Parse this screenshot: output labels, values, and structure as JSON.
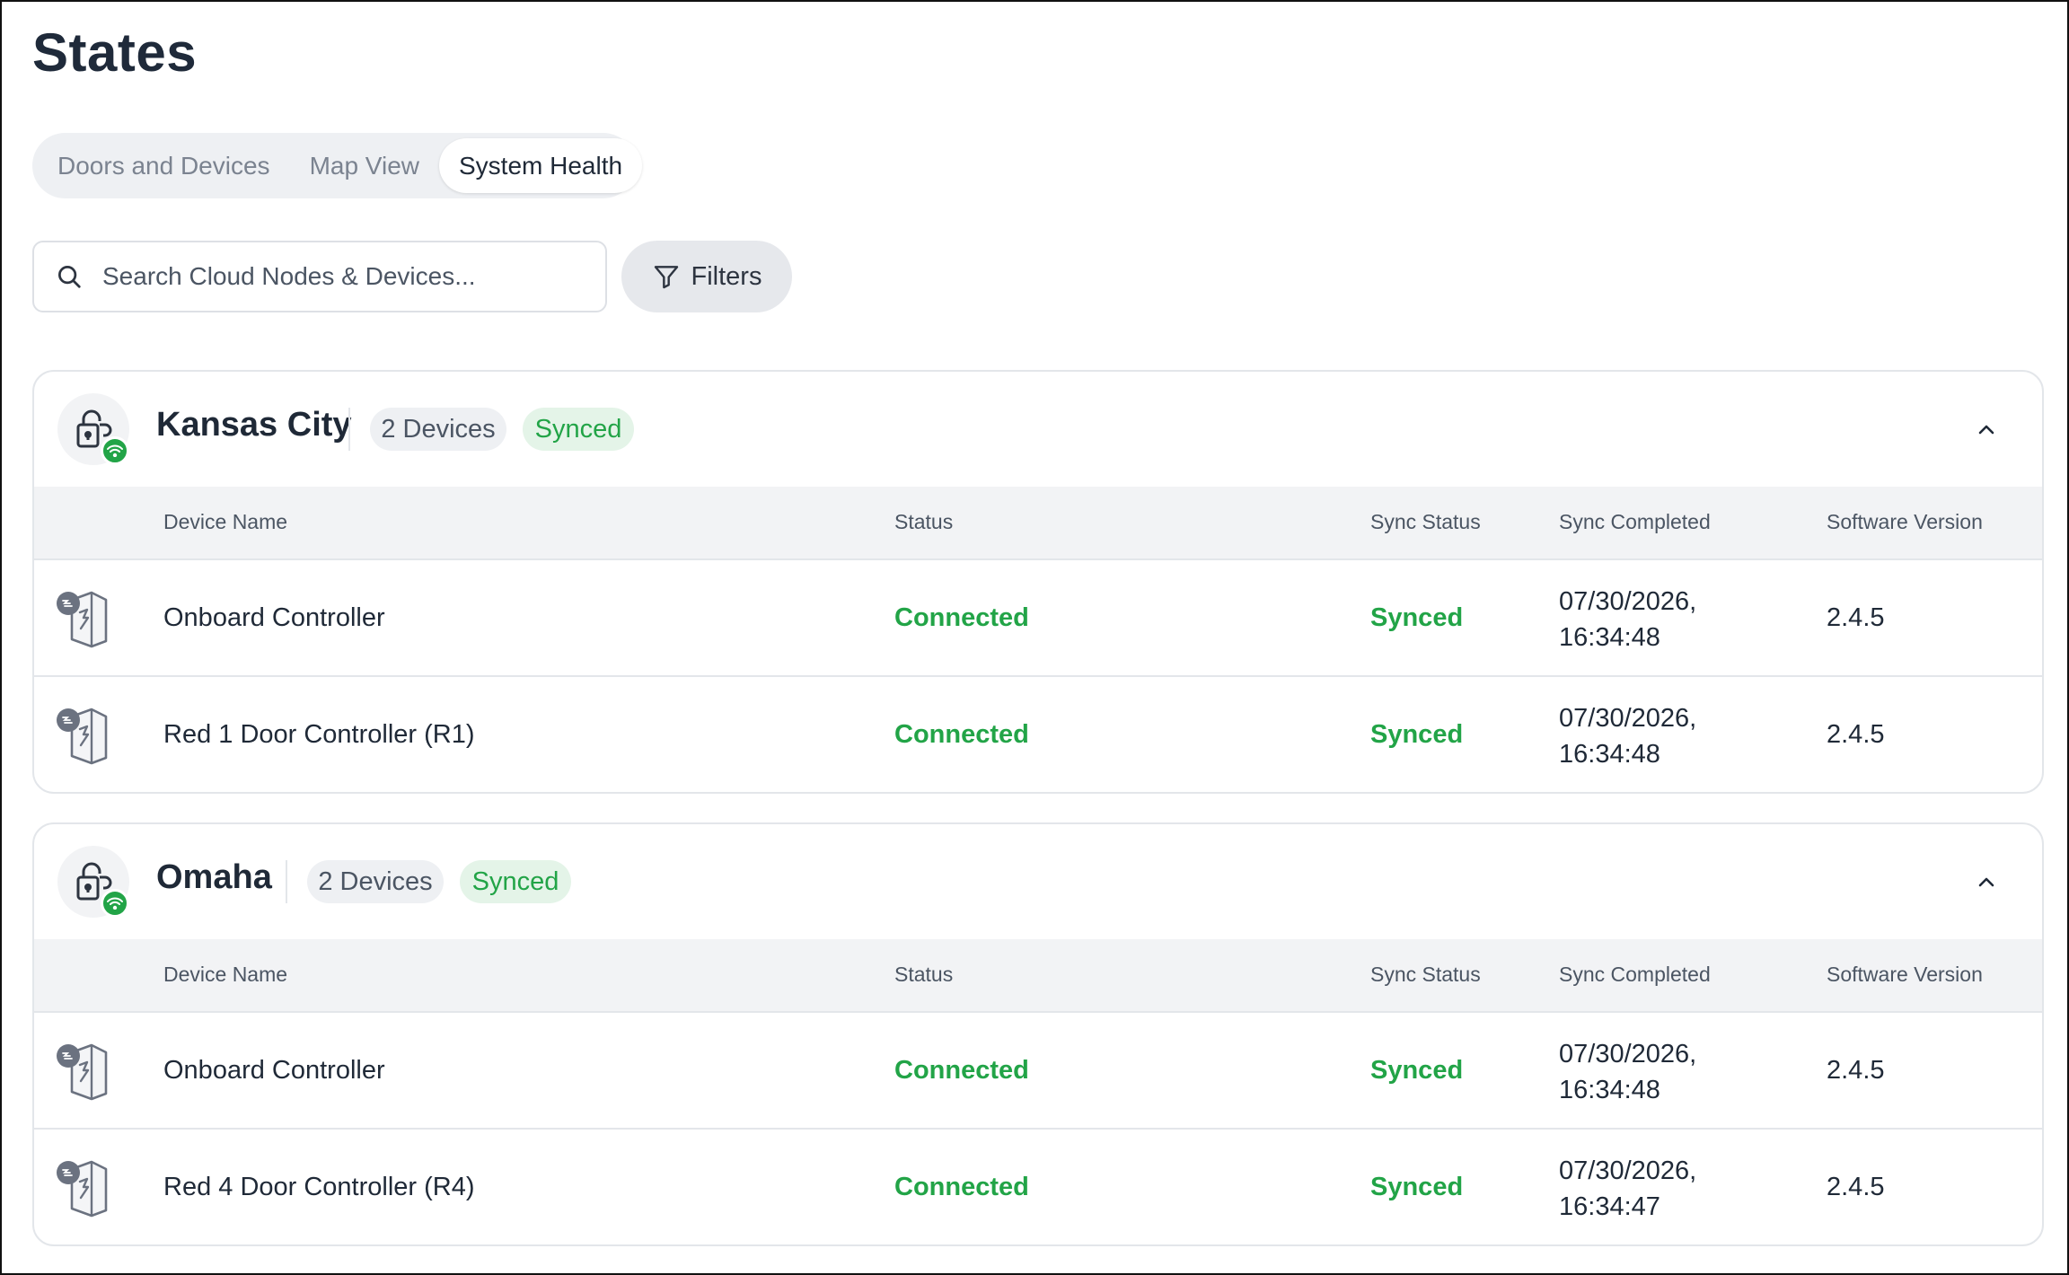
{
  "page": {
    "title": "States"
  },
  "tabs": [
    {
      "label": "Doors and Devices",
      "active": false
    },
    {
      "label": "Map View",
      "active": false
    },
    {
      "label": "System Health",
      "active": true
    }
  ],
  "search": {
    "placeholder": "Search Cloud Nodes & Devices...",
    "value": ""
  },
  "filters": {
    "label": "Filters"
  },
  "columns": {
    "device_name": "Device Name",
    "status": "Status",
    "sync_status": "Sync Status",
    "sync_completed": "Sync Completed",
    "software_version": "Software Version"
  },
  "nodes": [
    {
      "name": "Kansas City",
      "devices_badge": "2 Devices",
      "sync_badge": "Synced",
      "devices": [
        {
          "name": "Onboard Controller",
          "status": "Connected",
          "sync_status": "Synced",
          "sync_date": "07/30/2026,",
          "sync_time": "16:34:48",
          "version": "2.4.5"
        },
        {
          "name": "Red 1 Door Controller (R1)",
          "status": "Connected",
          "sync_status": "Synced",
          "sync_date": "07/30/2026,",
          "sync_time": "16:34:48",
          "version": "2.4.5"
        }
      ]
    },
    {
      "name": "Omaha",
      "devices_badge": "2 Devices",
      "sync_badge": "Synced",
      "devices": [
        {
          "name": "Onboard Controller",
          "status": "Connected",
          "sync_status": "Synced",
          "sync_date": "07/30/2026,",
          "sync_time": "16:34:48",
          "version": "2.4.5"
        },
        {
          "name": "Red 4 Door Controller (R4)",
          "status": "Connected",
          "sync_status": "Synced",
          "sync_date": "07/30/2026,",
          "sync_time": "16:34:47",
          "version": "2.4.5"
        }
      ]
    }
  ],
  "colors": {
    "success": "#22a447",
    "success_bg": "#e4f4e8",
    "muted_bg": "#eef0f3",
    "text": "#1f2937"
  },
  "icons": {
    "search": "search-icon",
    "filter": "filter-icon",
    "node": "cloud-node-lock-icon",
    "wifi": "wifi-icon",
    "device": "door-controller-icon",
    "collapse": "chevron-up-icon"
  }
}
